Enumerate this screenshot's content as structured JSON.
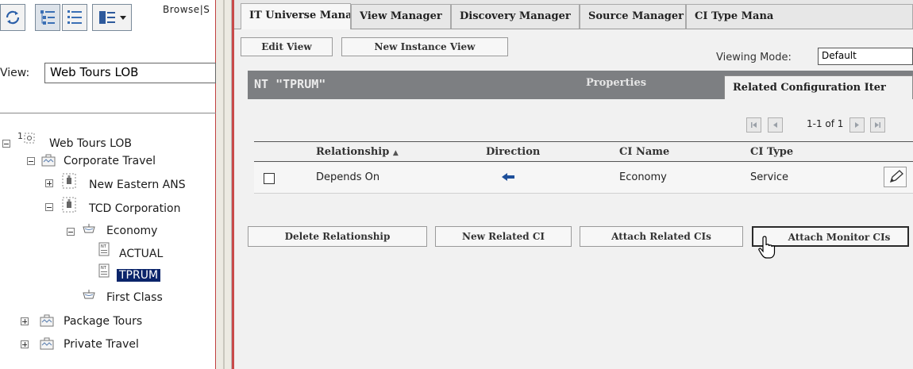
{
  "left_panel": {
    "browse_label": "Browse|S",
    "view_label": "View:",
    "view_value": "Web Tours LOB",
    "tree": {
      "root": {
        "label": "Web Tours LOB",
        "badge": "1"
      },
      "corporate_travel": "Corporate Travel",
      "new_eastern_ans": "New Eastern ANS",
      "tcd_corporation": "TCD Corporation",
      "economy": "Economy",
      "actual": "ACTUAL",
      "tprum": "TPRUM",
      "first_class": "First Class",
      "package_tours": "Package Tours",
      "private_travel": "Private Travel"
    },
    "toolbar_icons": [
      "refresh-icon",
      "tree-view-icon",
      "list-view-icon",
      "view-menu-icon"
    ]
  },
  "tabs": [
    "IT Universe Manager",
    "View Manager",
    "Discovery Manager",
    "Source Manager",
    "CI Type Mana"
  ],
  "toolbar": {
    "edit_view": "Edit View",
    "new_instance_view": "New Instance View",
    "viewing_mode_label": "Viewing Mode:",
    "viewing_mode_value": "Default"
  },
  "ci_panel": {
    "title": "NT \"TPRUM\"",
    "tabs": {
      "properties": "Properties",
      "related": "Related Configuration Iter"
    }
  },
  "pager": {
    "text": "1-1 of 1"
  },
  "table": {
    "columns": [
      "Relationship",
      "Direction",
      "CI Name",
      "CI Type"
    ],
    "rows": [
      {
        "relationship": "Depends On",
        "direction": "left-arrow-icon",
        "ci_name": "Economy",
        "ci_type": "Service"
      }
    ]
  },
  "actions": {
    "delete_relationship": "Delete Relationship",
    "new_related_ci": "New Related CI",
    "attach_related_cis": "Attach Related CIs",
    "attach_monitor_cis": "Attach Monitor CIs"
  },
  "colors": {
    "accent_red": "#c84a4a",
    "selection": "#0a246a",
    "header_bar": "#7d7f82",
    "arrow_blue": "#1d4f9a"
  }
}
